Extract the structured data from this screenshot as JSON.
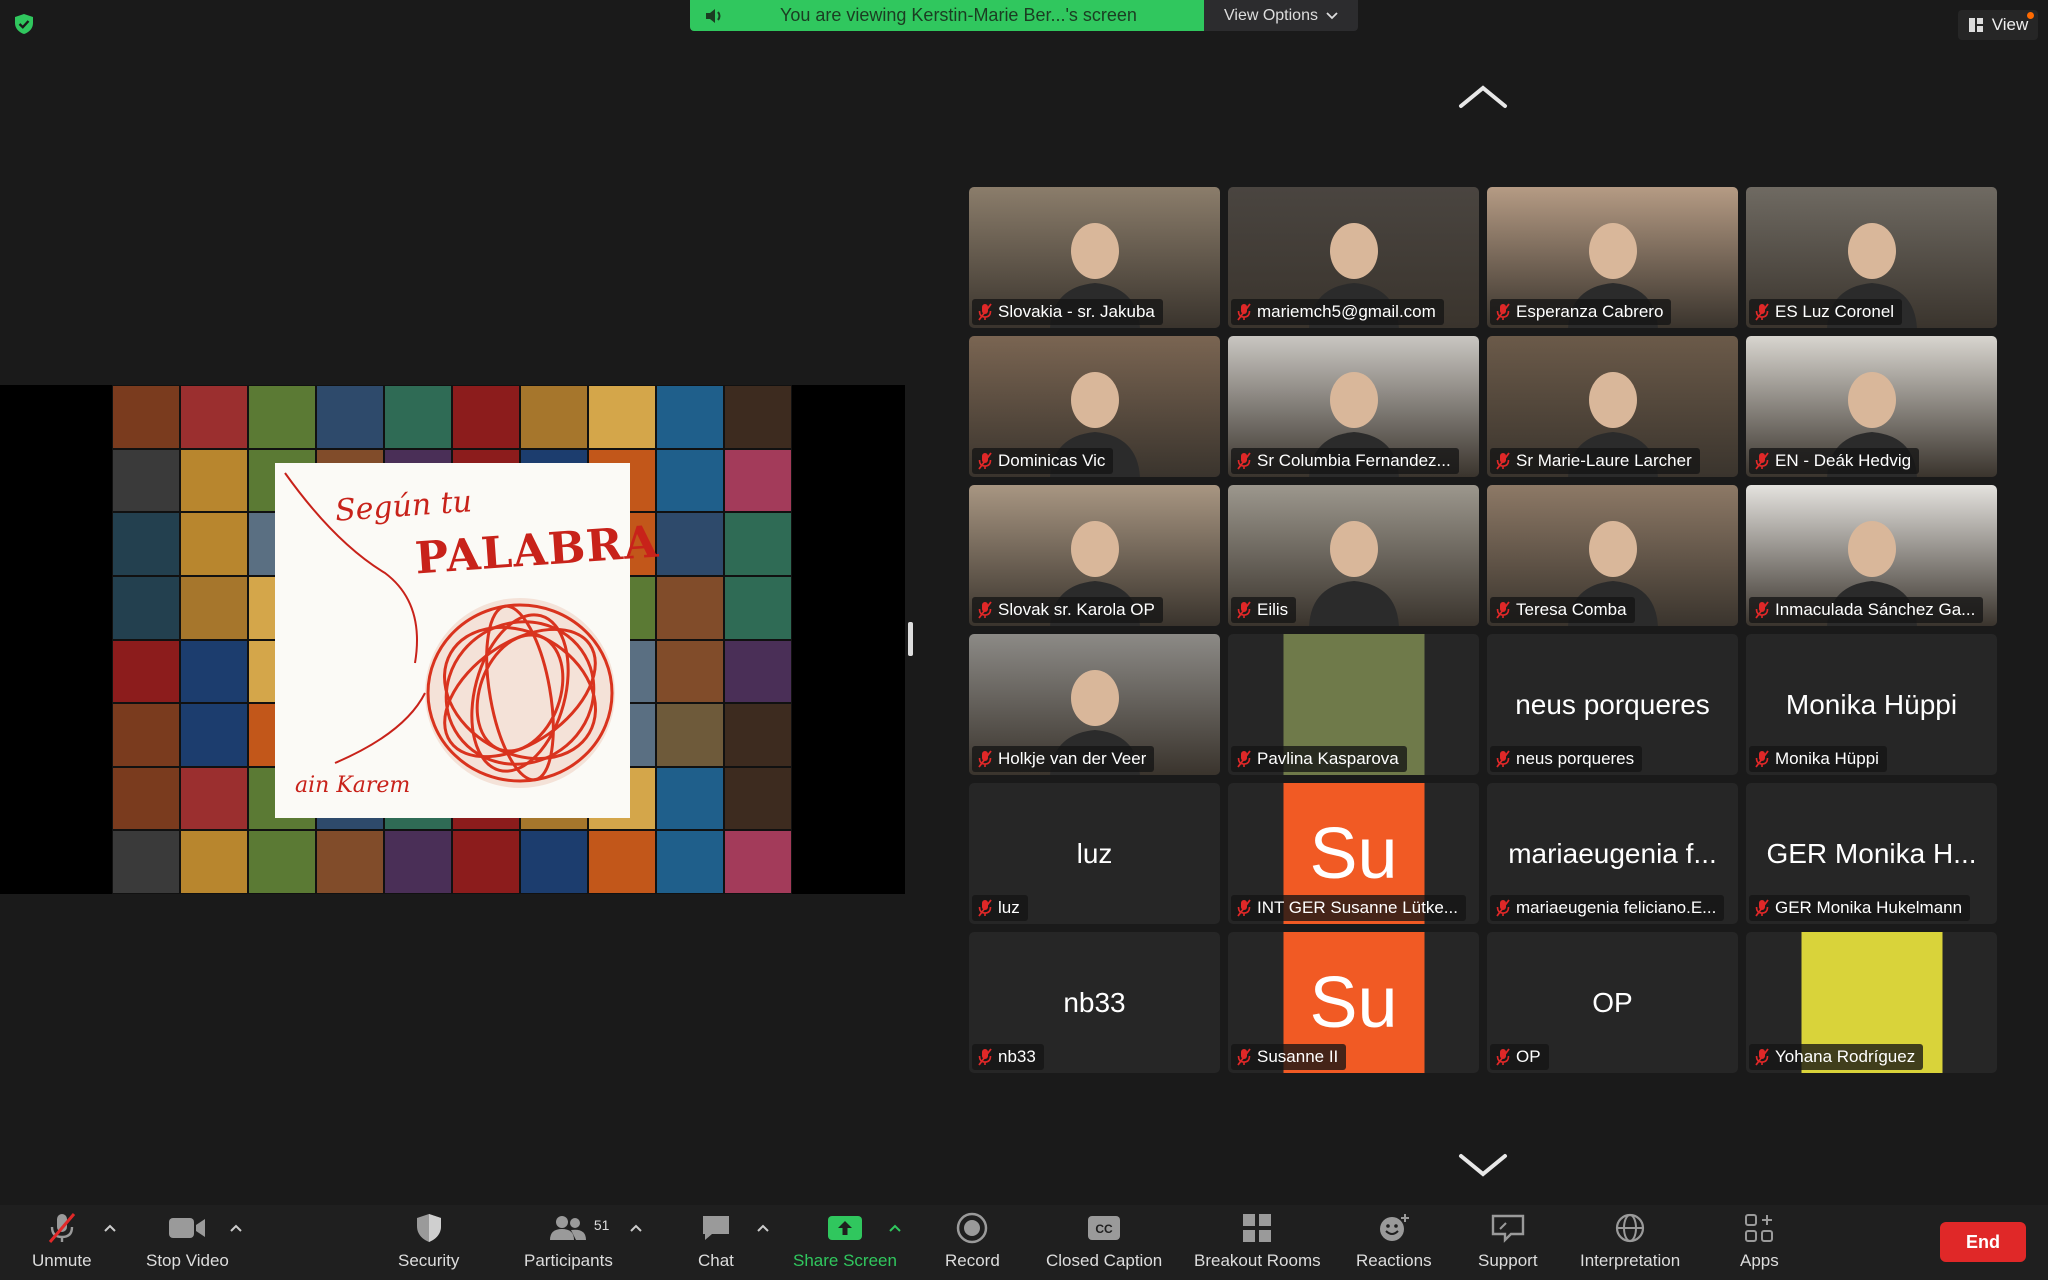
{
  "banner": {
    "viewing_text": "You are viewing Kerstin-Marie Ber...'s screen",
    "view_options": "View Options"
  },
  "view_button": "View",
  "shared_screen": {
    "cover_title_line1": "Según tu",
    "cover_title_line2": "PALABRA",
    "cover_signature": "ain Karem"
  },
  "participants": [
    {
      "name": "Slovakia - sr. Jakuba",
      "display": "video",
      "bg": "#8b7d6b"
    },
    {
      "name": "mariemch5@gmail.com",
      "display": "video",
      "bg": "#4a4540"
    },
    {
      "name": "Esperanza Cabrero",
      "display": "video",
      "bg": "#b59b84"
    },
    {
      "name": "ES Luz Coronel",
      "display": "video",
      "bg": "#6f6a62"
    },
    {
      "name": "Dominicas Vic",
      "display": "video",
      "bg": "#7a6552"
    },
    {
      "name": "Sr Columbia Fernandez...",
      "display": "video",
      "bg": "#c9c6c1"
    },
    {
      "name": "Sr Marie-Laure Larcher",
      "display": "video",
      "bg": "#6b5a49"
    },
    {
      "name": "EN - Deák Hedvig",
      "display": "video",
      "bg": "#d8d5cf"
    },
    {
      "name": "Slovak sr. Karola OP",
      "display": "video",
      "bg": "#a89682"
    },
    {
      "name": "Eilis",
      "display": "video",
      "bg": "#9c978d"
    },
    {
      "name": "Teresa Comba",
      "display": "video",
      "bg": "#8d7966"
    },
    {
      "name": "Inmaculada Sánchez Ga...",
      "display": "video",
      "bg": "#e4e2de"
    },
    {
      "name": "Holkje van der Veer",
      "display": "video",
      "bg": "#8c8a86"
    },
    {
      "name": "Pavlina Kasparova",
      "display": "photo",
      "bg": "#6f7a4a"
    },
    {
      "name": "neus porqueres",
      "display": "name",
      "big": "neus porqueres"
    },
    {
      "name": "Monika Hüppi",
      "display": "name",
      "big": "Monika Hüppi"
    },
    {
      "name": "luz",
      "display": "name",
      "big": "luz"
    },
    {
      "name": "INT GER Susanne Lütke...",
      "display": "avatar",
      "big": "Su"
    },
    {
      "name": "mariaeugenia feliciano.E...",
      "display": "name",
      "big": "mariaeugenia f..."
    },
    {
      "name": "GER Monika Hukelmann",
      "display": "name",
      "big": "GER Monika H..."
    },
    {
      "name": "nb33",
      "display": "name",
      "big": "nb33"
    },
    {
      "name": "Susanne II",
      "display": "avatar",
      "big": "Su"
    },
    {
      "name": "OP",
      "display": "name",
      "big": "OP"
    },
    {
      "name": "Yohana Rodríguez",
      "display": "photo",
      "bg": "#d9d33a"
    }
  ],
  "toolbar": {
    "unmute": "Unmute",
    "stop_video": "Stop Video",
    "security": "Security",
    "participants": "Participants",
    "participants_count": "51",
    "chat": "Chat",
    "share_screen": "Share Screen",
    "record": "Record",
    "closed_caption": "Closed Caption",
    "breakout_rooms": "Breakout Rooms",
    "reactions": "Reactions",
    "support": "Support",
    "interpretation": "Interpretation",
    "apps": "Apps",
    "end": "End"
  },
  "colors": {
    "accent_green": "#30c75e",
    "end_red": "#e02828",
    "avatar_orange": "#f15a24",
    "muted_red": "#e02828"
  }
}
